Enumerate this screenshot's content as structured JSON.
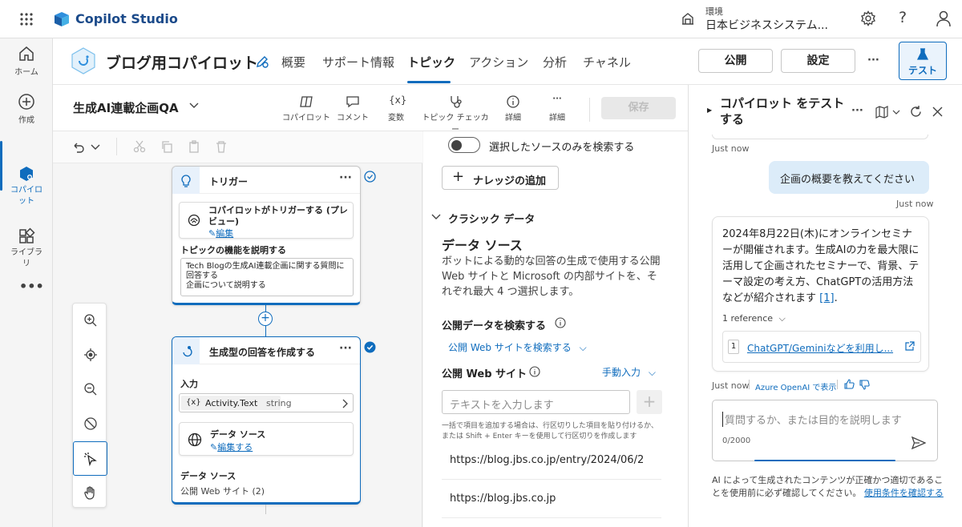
{
  "app": {
    "title": "Copilot Studio"
  },
  "environment": {
    "label": "環境",
    "name": "日本ビジネスシステム..."
  },
  "left_rail": [
    {
      "label": "ホーム"
    },
    {
      "label": "作成"
    },
    {
      "label": "コパイロ\nット"
    },
    {
      "label": "ライブラ\nリ"
    }
  ],
  "agent": {
    "name": "ブログ用コパイロット"
  },
  "nav_tabs": [
    "概要",
    "サポート情報",
    "トピック",
    "アクション",
    "分析",
    "チャネル"
  ],
  "header_buttons": {
    "publish": "公開",
    "settings": "設定",
    "test": "テスト"
  },
  "topic": {
    "name": "生成AI連載企画QA"
  },
  "topic_tools": [
    {
      "label": "コパイロット"
    },
    {
      "label": "コメント"
    },
    {
      "label": "変数"
    },
    {
      "label": "トピック チェッカー"
    },
    {
      "label": "詳細"
    },
    {
      "label": "詳細"
    }
  ],
  "save_label": "保存",
  "trigger_node": {
    "title": "トリガー",
    "card_title": "コパイロットがトリガーする (プレビュー)",
    "card_link": "編集",
    "describe_label": "トピックの機能を説明する",
    "describe_text": "Tech Blogの生成AI連載企画に関する質問に回答する\n企画について説明する"
  },
  "gen_node": {
    "title": "生成型の回答を作成する",
    "input_label": "入力",
    "input_var": "Activity.Text",
    "input_type": "string",
    "input_prefix": "{x}",
    "ds_card_title": "データ ソース",
    "ds_card_link": "編集する",
    "ds_label": "データ ソース",
    "ds_value": "公開 Web サイト (2)"
  },
  "knowledge": {
    "toggle_label": "選択したソースのみを検索する",
    "add_knowledge": "ナレッジの追加",
    "classic_data": "クラシック データ",
    "ds_title": "データ ソース",
    "ds_desc": "ボットによる動的な回答の生成で使用する公開 Web サイトと Microsoft の内部サイトを、それぞれ最大 4 つ選択します。",
    "search_public": "公開データを検索する",
    "search_web_dropdown": "公開 Web サイトを検索する",
    "public_web": "公開 Web サイト",
    "manual_input": "手動入力",
    "input_placeholder": "テキストを入力します",
    "hint": "一括で項目を追加する場合は、行区切りした項目を貼り付けるか、または Shift + Enter キーを使用して行区切りを作成します",
    "urls": [
      "https://blog.jbs.co.jp/entry/2024/06/2",
      "https://blog.jbs.co.jp"
    ]
  },
  "chat": {
    "title": "コパイロット をテストする",
    "time_top": "Just now",
    "user_message": "企画の概要を教えてください",
    "user_time": "Just now",
    "bot_message": "2024年8月22日(木)にオンラインセミナーが開催されます。生成AIの力を最大限に活用して企画されたセミナーで、背景、テーマ設定の考え方、ChatGPTの活用方法などが紹介されます",
    "bot_ref_marker": "[1]",
    "reference_toggle": "1 reference",
    "reference_index": "1",
    "reference_title": "ChatGPT/Geminiなどを利用し...",
    "bot_time": "Just now",
    "bot_source": "Azure OpenAI で表示",
    "input_placeholder": "質問するか、または目的を説明します",
    "char_count": "0/2000",
    "disclaimer": "AI によって生成されたコンテンツが正確かつ適切であることを使用前に必ず確認してください。",
    "terms_link": "使用条件を確認する"
  },
  "colors": {
    "accent": "#0f6cbd",
    "user_bubble": "#dcecf9",
    "brand": "#1b4a8a"
  }
}
